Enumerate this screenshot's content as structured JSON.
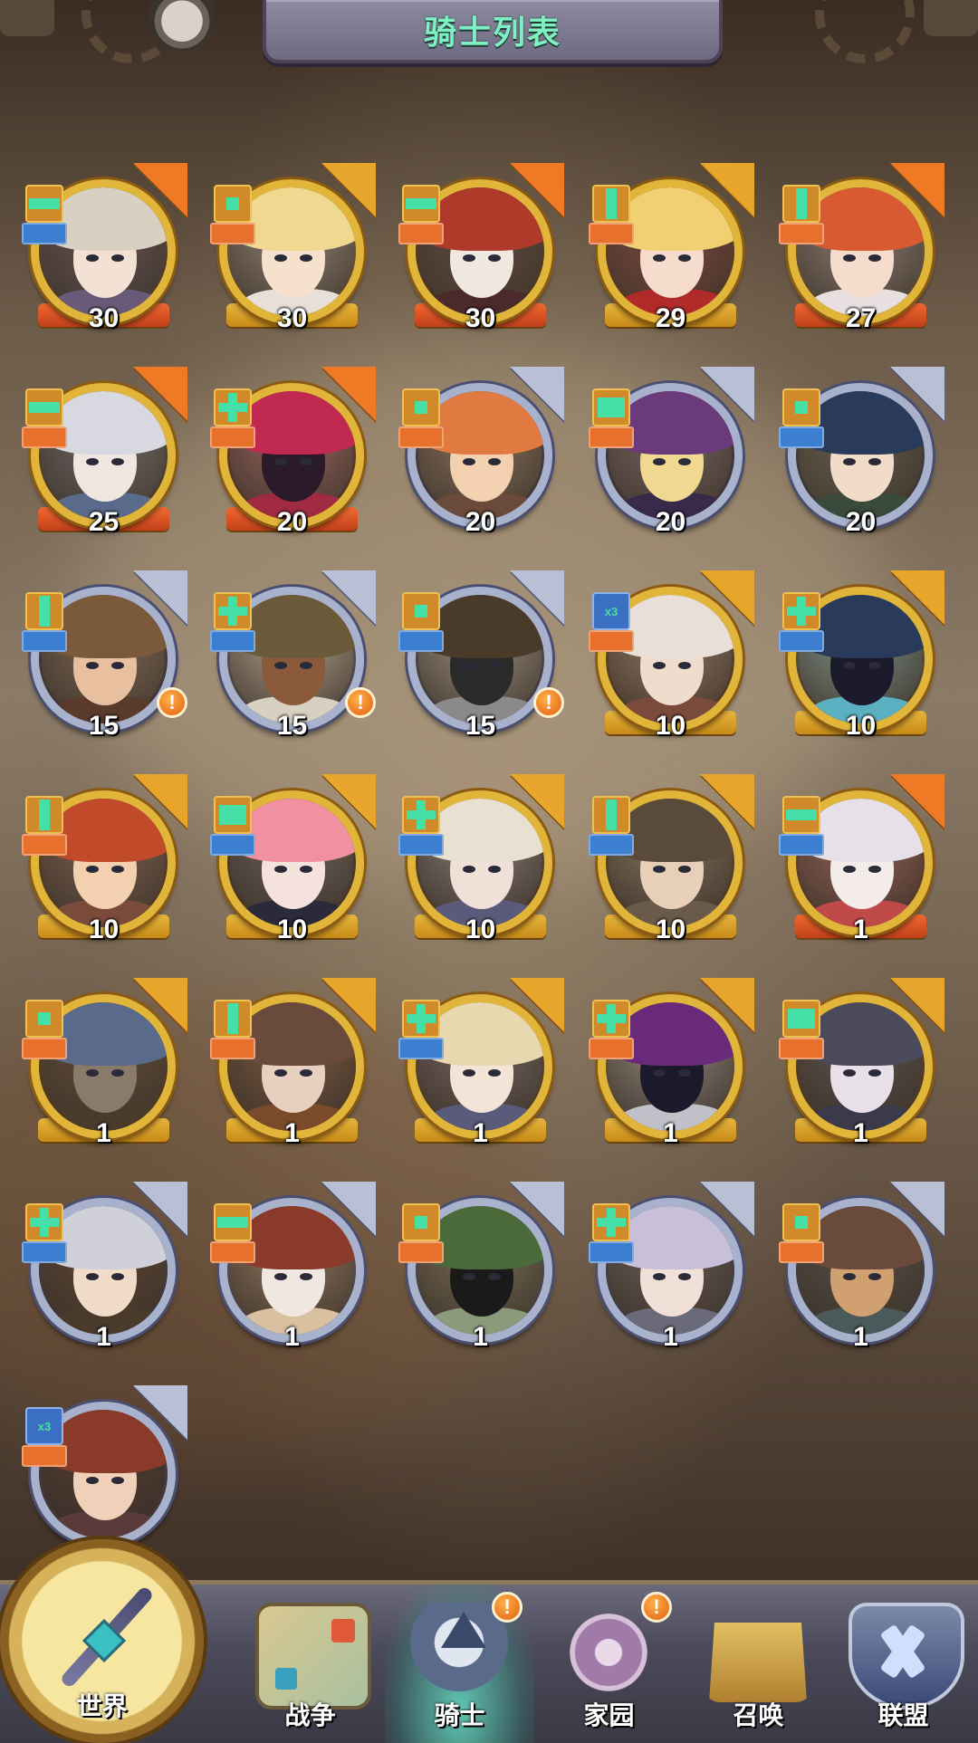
{
  "header": {
    "title": "骑士列表"
  },
  "knights": [
    {
      "level": "30",
      "frame": "gold",
      "flag": "orange",
      "shape": "bar",
      "role_color": "blue"
    },
    {
      "level": "30",
      "frame": "gold",
      "flag": "gold",
      "shape": "dot",
      "role_color": "orange"
    },
    {
      "level": "30",
      "frame": "gold",
      "flag": "orange",
      "shape": "bar",
      "role_color": "orange"
    },
    {
      "level": "29",
      "frame": "gold",
      "flag": "gold",
      "shape": "vbar",
      "role_color": "orange"
    },
    {
      "level": "27",
      "frame": "gold",
      "flag": "orange",
      "shape": "vbar",
      "role_color": "orange"
    },
    {
      "level": "25",
      "frame": "gold",
      "flag": "orange",
      "shape": "bar",
      "role_color": "orange"
    },
    {
      "level": "20",
      "frame": "gold",
      "flag": "orange",
      "shape": "plus",
      "role_color": "orange"
    },
    {
      "level": "20",
      "frame": "silver",
      "flag": "none",
      "shape": "dot",
      "role_color": "orange"
    },
    {
      "level": "20",
      "frame": "silver",
      "flag": "none",
      "shape": "grid",
      "role_color": "orange"
    },
    {
      "level": "20",
      "frame": "silver",
      "flag": "none",
      "shape": "dot",
      "role_color": "blue"
    },
    {
      "level": "15",
      "frame": "silver",
      "flag": "none",
      "shape": "vbar",
      "role_color": "blue",
      "alert": "!"
    },
    {
      "level": "15",
      "frame": "silver",
      "flag": "none",
      "shape": "plus",
      "role_color": "blue",
      "alert": "!"
    },
    {
      "level": "15",
      "frame": "silver",
      "flag": "none",
      "shape": "dot",
      "role_color": "blue",
      "alert": "!"
    },
    {
      "level": "10",
      "frame": "gold",
      "flag": "gold",
      "shape": "x3",
      "role_color": "orange"
    },
    {
      "level": "10",
      "frame": "gold",
      "flag": "gold",
      "shape": "plus",
      "role_color": "blue"
    },
    {
      "level": "10",
      "frame": "gold",
      "flag": "gold",
      "shape": "vbar",
      "role_color": "orange"
    },
    {
      "level": "10",
      "frame": "gold",
      "flag": "gold",
      "shape": "grid",
      "role_color": "blue"
    },
    {
      "level": "10",
      "frame": "gold",
      "flag": "gold",
      "shape": "plus",
      "role_color": "blue"
    },
    {
      "level": "10",
      "frame": "gold",
      "flag": "gold",
      "shape": "vbar",
      "role_color": "blue"
    },
    {
      "level": "1",
      "frame": "gold",
      "flag": "orange",
      "shape": "bar",
      "role_color": "blue"
    },
    {
      "level": "1",
      "frame": "gold",
      "flag": "gold",
      "shape": "dot",
      "role_color": "orange"
    },
    {
      "level": "1",
      "frame": "gold",
      "flag": "gold",
      "shape": "vbar",
      "role_color": "orange"
    },
    {
      "level": "1",
      "frame": "gold",
      "flag": "gold",
      "shape": "plus",
      "role_color": "blue"
    },
    {
      "level": "1",
      "frame": "gold",
      "flag": "gold",
      "shape": "plus",
      "role_color": "orange"
    },
    {
      "level": "1",
      "frame": "gold",
      "flag": "gold",
      "shape": "grid",
      "role_color": "orange"
    },
    {
      "level": "1",
      "frame": "silver",
      "flag": "none",
      "shape": "plus",
      "role_color": "blue"
    },
    {
      "level": "1",
      "frame": "silver",
      "flag": "none",
      "shape": "bar",
      "role_color": "orange"
    },
    {
      "level": "1",
      "frame": "silver",
      "flag": "none",
      "shape": "dot",
      "role_color": "orange"
    },
    {
      "level": "1",
      "frame": "silver",
      "flag": "none",
      "shape": "plus",
      "role_color": "blue"
    },
    {
      "level": "1",
      "frame": "silver",
      "flag": "none",
      "shape": "dot",
      "role_color": "orange"
    },
    {
      "level": "",
      "frame": "silver",
      "flag": "none",
      "shape": "x3",
      "role_color": "orange"
    }
  ],
  "x3_label": "x3",
  "nav": {
    "world": "世界",
    "war": "战争",
    "knight": "骑士",
    "home": "家园",
    "summon": "召唤",
    "alliance": "联盟"
  },
  "alerts": {
    "knight": "!",
    "home": "!"
  },
  "colors": {
    "gold_frame": "#e0b53a",
    "silver_frame": "#a9b2cc",
    "title_text": "#7ef0c4",
    "role_orange": "#e6702c",
    "role_blue": "#3c7fd0",
    "alert": "#e06010"
  }
}
